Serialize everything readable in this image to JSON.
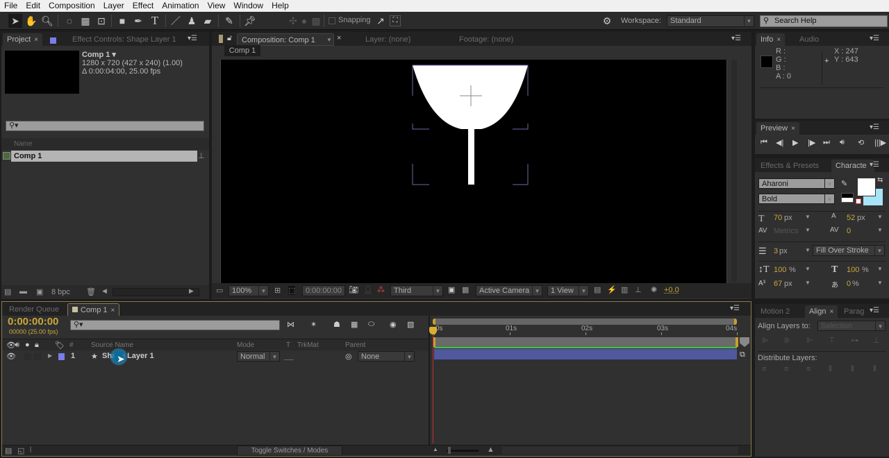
{
  "menubar": [
    "File",
    "Edit",
    "Composition",
    "Layer",
    "Effect",
    "Animation",
    "View",
    "Window",
    "Help"
  ],
  "toolbar": {
    "tools": [
      "selection-tool",
      "hand-tool",
      "zoom-tool",
      "rotation-tool",
      "camera-tool",
      "pan-behind-tool",
      "rectangle-tool",
      "pen-tool",
      "type-tool",
      "brush-tool",
      "clone-stamp-tool",
      "eraser-tool",
      "roto-brush-tool",
      "puppet-pin-tool"
    ],
    "snapping_label": "Snapping",
    "workspace_label": "Workspace:",
    "workspace_value": "Standard",
    "search_placeholder": "Search Help"
  },
  "project_panel": {
    "tab_project": "Project",
    "tab_effect_controls": "Effect Controls: Shape Layer 1",
    "comp_name": "Comp 1 ▾",
    "comp_res": "1280 x 720  (427 x 240) (1.00)",
    "comp_duration": "Δ 0:00:04:00, 25.00 fps",
    "search_placeholder": "",
    "column_name": "Name",
    "items": [
      {
        "name": "Comp 1"
      }
    ],
    "bpc": "8 bpc"
  },
  "composition_panel": {
    "tab_comp": "Composition: Comp 1",
    "tab_layer": "Layer: (none)",
    "tab_footage": "Footage: (none)",
    "breadcrumb": "Comp 1",
    "zoom": "100%",
    "timecode": "0:00:00:00",
    "resolution": "Third",
    "camera": "Active Camera",
    "views": "1 View",
    "exposure": "+0.0"
  },
  "info_panel": {
    "tab_info": "Info",
    "tab_audio": "Audio",
    "r": "R :",
    "g": "G :",
    "b": "B :",
    "a": "A :  0",
    "x": "X : 247",
    "y": "Y : 643"
  },
  "preview_panel": {
    "tab": "Preview"
  },
  "character_panel": {
    "tab_effects": "Effects & Presets",
    "tab_character": "Characte",
    "font_family": "Aharoni",
    "font_style": "Bold",
    "font_size": "70",
    "font_size_unit": "px",
    "leading": "52",
    "leading_unit": "px",
    "kerning": "Metrics",
    "tracking": "0",
    "stroke_width": "3",
    "stroke_unit": "px",
    "stroke_mode": "Fill Over Stroke",
    "vert_scale": "100",
    "vert_unit": "%",
    "horiz_scale": "100",
    "horiz_unit": "%",
    "baseline": "67",
    "baseline_unit": "px",
    "tsume": "0",
    "tsume_unit": "%",
    "fill_color": "#ffffff",
    "stroke_color": "#a8e4f8"
  },
  "align_panel": {
    "tab_motion": "Motion 2",
    "tab_align": "Align",
    "tab_parag": "Parag",
    "align_to_label": "Align Layers to:",
    "align_to_value": "Selection",
    "distribute_label": "Distribute Layers:"
  },
  "timeline": {
    "tab_render": "Render Queue",
    "tab_comp": "Comp 1",
    "timecode": "0:00:00:00",
    "frame_info": "00000 (25.00 fps)",
    "columns": {
      "num": "#",
      "source": "Source Name",
      "mode": "Mode",
      "t": "T",
      "trkmat": "TrkMat",
      "parent": "Parent"
    },
    "layers": [
      {
        "num": "1",
        "name": "Shape Layer 1",
        "mode": "Normal",
        "parent": "None",
        "color": "#7a7ee8"
      }
    ],
    "ruler": [
      "0s",
      "01s",
      "02s",
      "03s",
      "04s"
    ],
    "toggle_label": "Toggle Switches / Modes"
  }
}
